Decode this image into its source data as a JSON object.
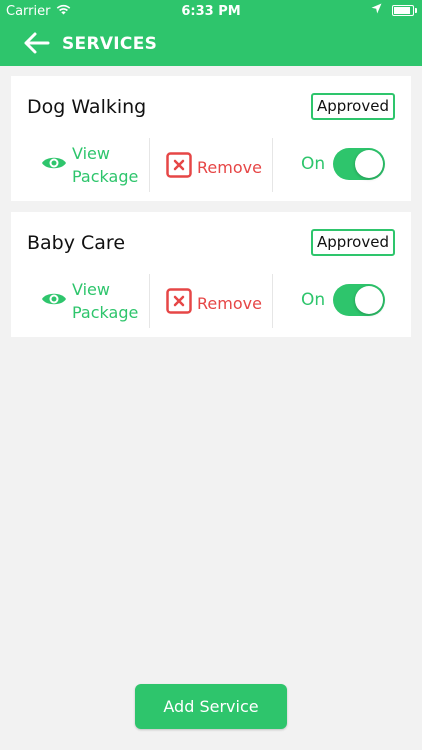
{
  "status_bar": {
    "carrier": "Carrier",
    "time": "6:33 PM"
  },
  "header": {
    "title": "SERVICES",
    "back_icon": "arrow-left-icon",
    "color": "#2ec56c"
  },
  "services": [
    {
      "name": "Dog Walking",
      "status": "Approved",
      "view_label_line1": "View",
      "view_label_line2": "Package",
      "remove_label": "Remove",
      "toggle_label": "On",
      "enabled": true
    },
    {
      "name": "Baby Care",
      "status": "Approved",
      "view_label_line1": "View",
      "view_label_line2": "Package",
      "remove_label": "Remove",
      "toggle_label": "On",
      "enabled": true
    }
  ],
  "footer": {
    "add_label": "Add Service"
  },
  "colors": {
    "accent": "#2ec56c",
    "danger": "#e64646",
    "background": "#f2f2f2"
  }
}
